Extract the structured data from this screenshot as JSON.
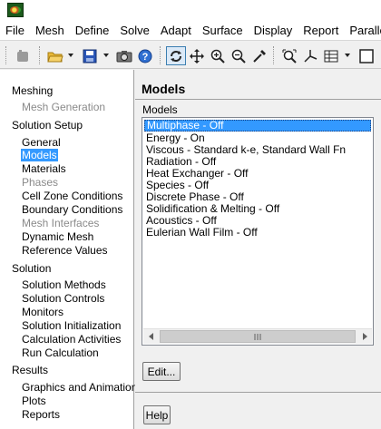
{
  "menubar": {
    "items": [
      "File",
      "Mesh",
      "Define",
      "Solve",
      "Adapt",
      "Surface",
      "Display",
      "Report",
      "Parallel"
    ]
  },
  "toolbar": {
    "icons": [
      "read-case-icon",
      "open-file-icon",
      "save-icon",
      "snapshot-icon",
      "help-icon",
      "rotate-icon",
      "pan-icon",
      "zoom-in-icon",
      "zoom-to-fit-icon",
      "probe-icon",
      "fit-to-window-icon",
      "axes-icon",
      "layout-icon",
      "window-icon"
    ]
  },
  "tree": {
    "sections": [
      {
        "label": "Meshing",
        "items": [
          {
            "label": "Mesh Generation",
            "state": "disabled"
          }
        ]
      },
      {
        "label": "Solution Setup",
        "items": [
          {
            "label": "General",
            "state": "normal"
          },
          {
            "label": "Models",
            "state": "selected"
          },
          {
            "label": "Materials",
            "state": "normal"
          },
          {
            "label": "Phases",
            "state": "disabled"
          },
          {
            "label": "Cell Zone Conditions",
            "state": "normal"
          },
          {
            "label": "Boundary Conditions",
            "state": "normal"
          },
          {
            "label": "Mesh Interfaces",
            "state": "disabled"
          },
          {
            "label": "Dynamic Mesh",
            "state": "normal"
          },
          {
            "label": "Reference Values",
            "state": "normal"
          }
        ]
      },
      {
        "label": "Solution",
        "items": [
          {
            "label": "Solution Methods",
            "state": "normal"
          },
          {
            "label": "Solution Controls",
            "state": "normal"
          },
          {
            "label": "Monitors",
            "state": "normal"
          },
          {
            "label": "Solution Initialization",
            "state": "normal"
          },
          {
            "label": "Calculation Activities",
            "state": "normal"
          },
          {
            "label": "Run Calculation",
            "state": "normal"
          }
        ]
      },
      {
        "label": "Results",
        "items": [
          {
            "label": "Graphics and Animations",
            "state": "normal"
          },
          {
            "label": "Plots",
            "state": "normal"
          },
          {
            "label": "Reports",
            "state": "normal"
          }
        ]
      }
    ]
  },
  "panel": {
    "title": "Models",
    "list_label": "Models",
    "models": [
      "Multiphase - Off",
      "Energy - On",
      "Viscous - Standard k-e, Standard Wall Fn",
      "Radiation - Off",
      "Heat Exchanger - Off",
      "Species - Off",
      "Discrete Phase - Off",
      "Solidification & Melting - Off",
      "Acoustics - Off",
      "Eulerian Wall Film - Off"
    ],
    "selected_index": 0,
    "edit_label": "Edit...",
    "help_label": "Help"
  },
  "colors": {
    "selection": "#3399ff",
    "disabled_text": "#8a8a8a"
  }
}
